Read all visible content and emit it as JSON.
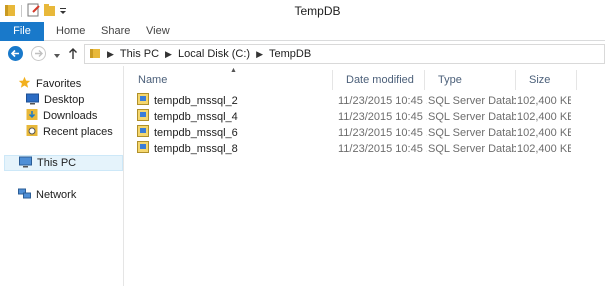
{
  "window": {
    "title": "TempDB"
  },
  "ribbon": {
    "tabs": [
      "File",
      "Home",
      "Share",
      "View"
    ]
  },
  "address": {
    "crumbs": [
      "This PC",
      "Local Disk (C:)",
      "TempDB"
    ]
  },
  "nav": {
    "favorites_label": "Favorites",
    "favorites": [
      "Desktop",
      "Downloads",
      "Recent places"
    ],
    "this_pc": "This PC",
    "network": "Network"
  },
  "columns": {
    "name": "Name",
    "date": "Date modified",
    "type": "Type",
    "size": "Size"
  },
  "files": [
    {
      "name": "tempdb_mssql_2",
      "date": "11/23/2015 10:45 ...",
      "type": "SQL Server Databa...",
      "size": "102,400 KB"
    },
    {
      "name": "tempdb_mssql_4",
      "date": "11/23/2015 10:45 ...",
      "type": "SQL Server Databa...",
      "size": "102,400 KB"
    },
    {
      "name": "tempdb_mssql_6",
      "date": "11/23/2015 10:45 ...",
      "type": "SQL Server Databa...",
      "size": "102,400 KB"
    },
    {
      "name": "tempdb_mssql_8",
      "date": "11/23/2015 10:45 ...",
      "type": "SQL Server Databa...",
      "size": "102,400 KB"
    }
  ],
  "colors": {
    "file_tab": "#1979ca",
    "folder": "#e8b83a",
    "selection": "#e5f3fb"
  }
}
